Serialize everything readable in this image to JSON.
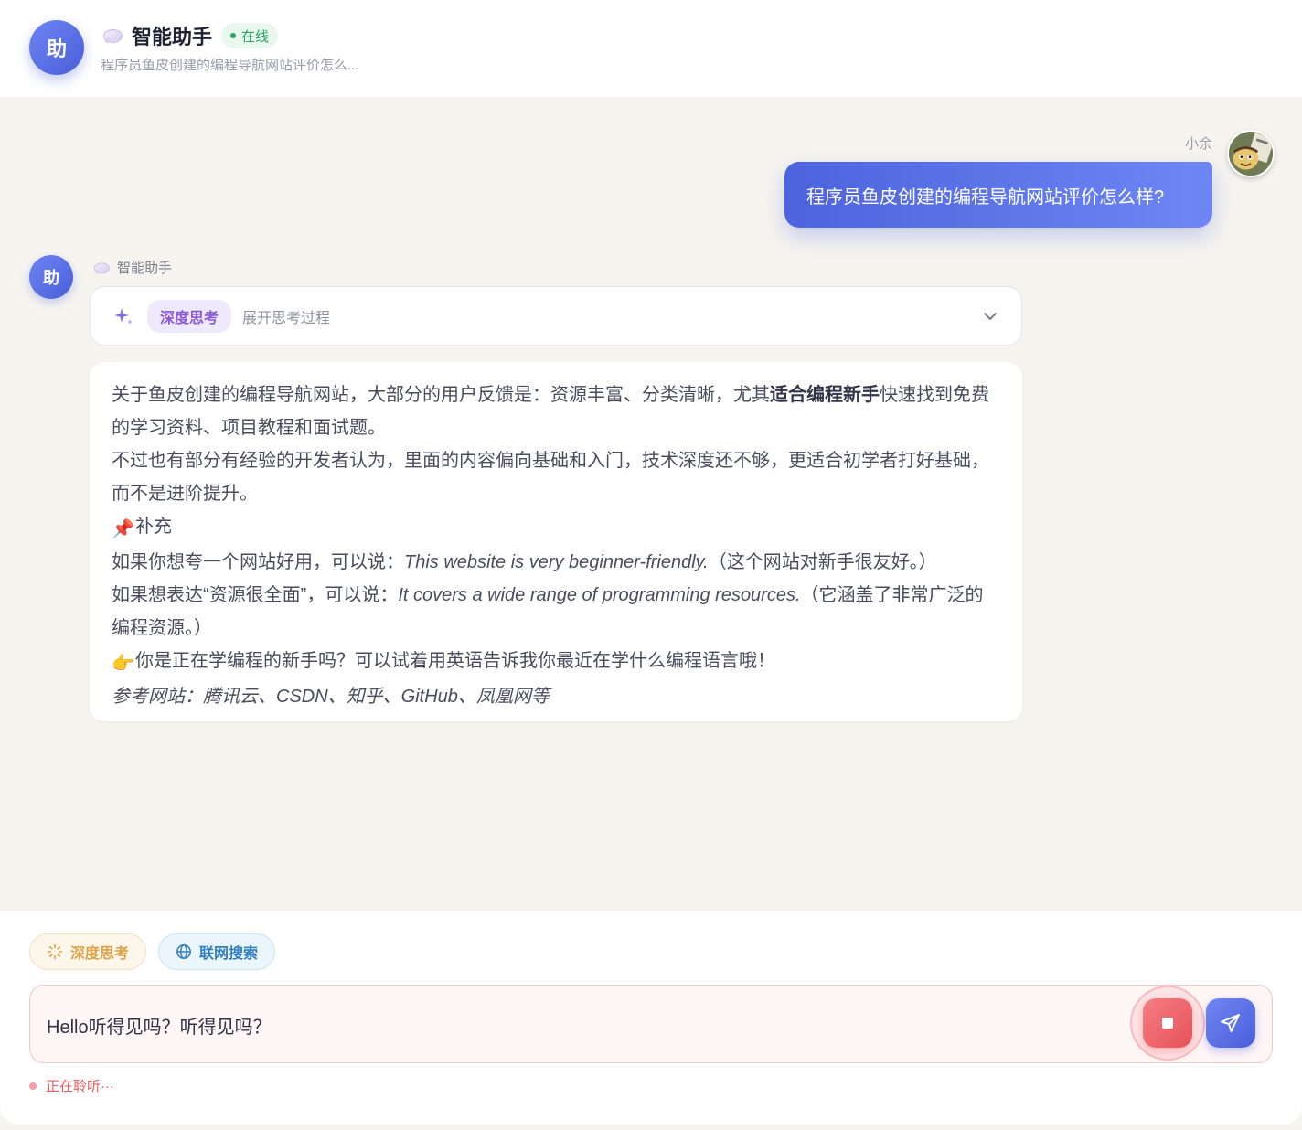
{
  "header": {
    "avatar_text": "助",
    "title": "智能助手",
    "status": "在线",
    "subtitle": "程序员鱼皮创建的编程导航网站评价怎么..."
  },
  "messages": {
    "user": {
      "name": "小余",
      "text": "程序员鱼皮创建的编程导航网站评价怎么样?"
    },
    "bot": {
      "avatar_text": "助",
      "name": "智能助手",
      "thinking": {
        "tag": "深度思考",
        "expand_label": "展开思考过程"
      },
      "answer": {
        "p1_a": "关于鱼皮创建的编程导航网站，大部分的用户反馈是：资源丰富、分类清晰，尤其",
        "p1_bold": "适合编程新手",
        "p1_b": "快速找到免费的学习资料、项目教程和面试题。",
        "p2": "不过也有部分有经验的开发者认为，里面的内容偏向基础和入门，技术深度还不够，更适合初学者打好基础，而不是进阶提升。",
        "p3_icon": "📌",
        "p3": "补充",
        "p4_a": "如果你想夸一个网站好用，可以说：",
        "p4_em": "This website is very beginner-friendly.",
        "p4_b": "（这个网站对新手很友好。）",
        "p5_a": "如果想表达“资源很全面”，可以说：",
        "p5_em": "It covers a wide range of programming resources.",
        "p5_b": "（它涵盖了非常广泛的编程资源。）",
        "p6_icon": "👉",
        "p6": "你是正在学编程的新手吗？可以试着用英语告诉我你最近在学什么编程语言哦！",
        "p7": "参考网站：腾讯云、CSDN、知乎、GitHub、凤凰网等"
      }
    }
  },
  "composer": {
    "chip_think": "深度思考",
    "chip_web": "联网搜索",
    "input_value": "Hello听得见吗？听得见吗？",
    "listening_text": "正在聆听···"
  },
  "colors": {
    "accent": "#4d63dd",
    "online": "#2aa363",
    "stop": "#e45257",
    "think_chip": "#e0a247",
    "web_chip": "#2f7fc1"
  }
}
